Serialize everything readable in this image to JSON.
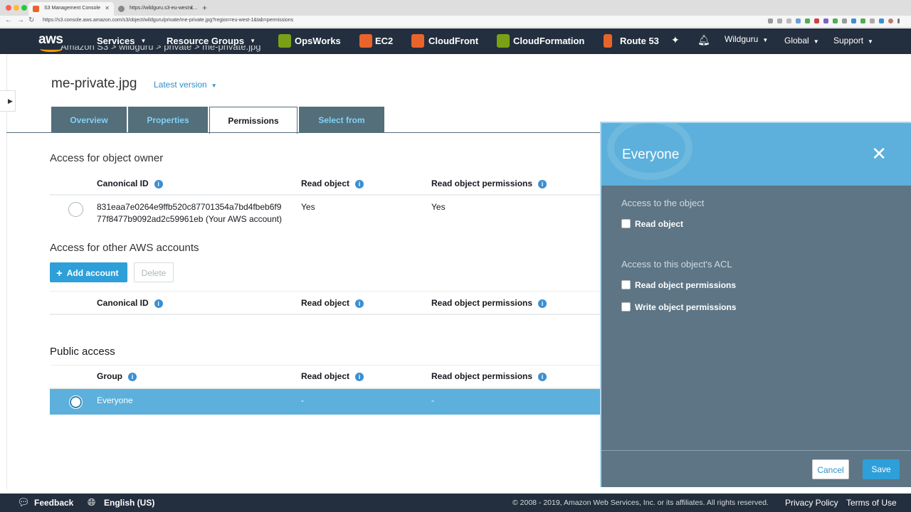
{
  "browser": {
    "tabs": [
      {
        "label": "S3 Management Console",
        "active": true,
        "favicon_color": "#e8642b"
      },
      {
        "label": "https://wildguru.s3-eu-west-1...",
        "active": false,
        "favicon_color": "#888888"
      }
    ],
    "url": "https://s3.console.aws.amazon.com/s3/object/wildguru/private/me-private.jpg?region=eu-west-1&tab=permissions"
  },
  "nav": {
    "logo": "aws",
    "services": "Services",
    "resource_groups": "Resource Groups",
    "shortcuts": [
      {
        "label": "OpsWorks",
        "color": "#7aa116"
      },
      {
        "label": "EC2",
        "color": "#e8642b"
      },
      {
        "label": "CloudFront",
        "color": "#e8642b"
      },
      {
        "label": "CloudFormation",
        "color": "#7aa116"
      },
      {
        "label": "Route 53",
        "color": "#e8642b"
      }
    ],
    "account": "Wildguru",
    "region": "Global",
    "support": "Support"
  },
  "page": {
    "breadcrumb": "Amazon S3  >  wildguru  >  private  >  me-private.jpg",
    "object_title": "me-private.jpg",
    "version": "Latest version",
    "tabs": [
      "Overview",
      "Properties",
      "Permissions",
      "Select from"
    ],
    "active_tab": "Permissions"
  },
  "owner": {
    "heading": "Access for object owner",
    "columns": [
      "Canonical ID",
      "Read object",
      "Read object permissions"
    ],
    "row": {
      "id_line1": "831eaa7e0264e9ffb520c87701354a7bd4fbeb6f9",
      "id_line2": "77f8477b9092ad2c59961eb (Your AWS account)",
      "read_object": "Yes",
      "read_perms": "Yes"
    }
  },
  "other_accounts": {
    "heading": "Access for other AWS accounts",
    "add_label": "Add account",
    "delete_label": "Delete",
    "columns": [
      "Canonical ID",
      "Read object",
      "Read object permissions"
    ]
  },
  "public_access": {
    "heading": "Public access",
    "columns": [
      "Group",
      "Read object",
      "Read object permissions"
    ],
    "row": {
      "group": "Everyone",
      "read_object": "-",
      "read_perms": "-"
    }
  },
  "panel": {
    "title": "Everyone",
    "object_section": "Access to the object",
    "read_object": "Read object",
    "acl_section": "Access to this object's ACL",
    "read_perms": "Read object permissions",
    "write_perms": "Write object permissions",
    "cancel": "Cancel",
    "save": "Save"
  },
  "footer": {
    "feedback": "Feedback",
    "language": "English (US)",
    "copyright": "© 2008 - 2019, Amazon Web Services, Inc. or its affiliates. All rights reserved.",
    "privacy": "Privacy Policy",
    "terms": "Terms of Use"
  },
  "colors": {
    "nav_bg": "#232f3e",
    "accent_blue": "#2e9fd8",
    "selected_row": "#5cb0db",
    "panel_bg": "#5d7584",
    "tab_inactive": "#546e7a"
  }
}
